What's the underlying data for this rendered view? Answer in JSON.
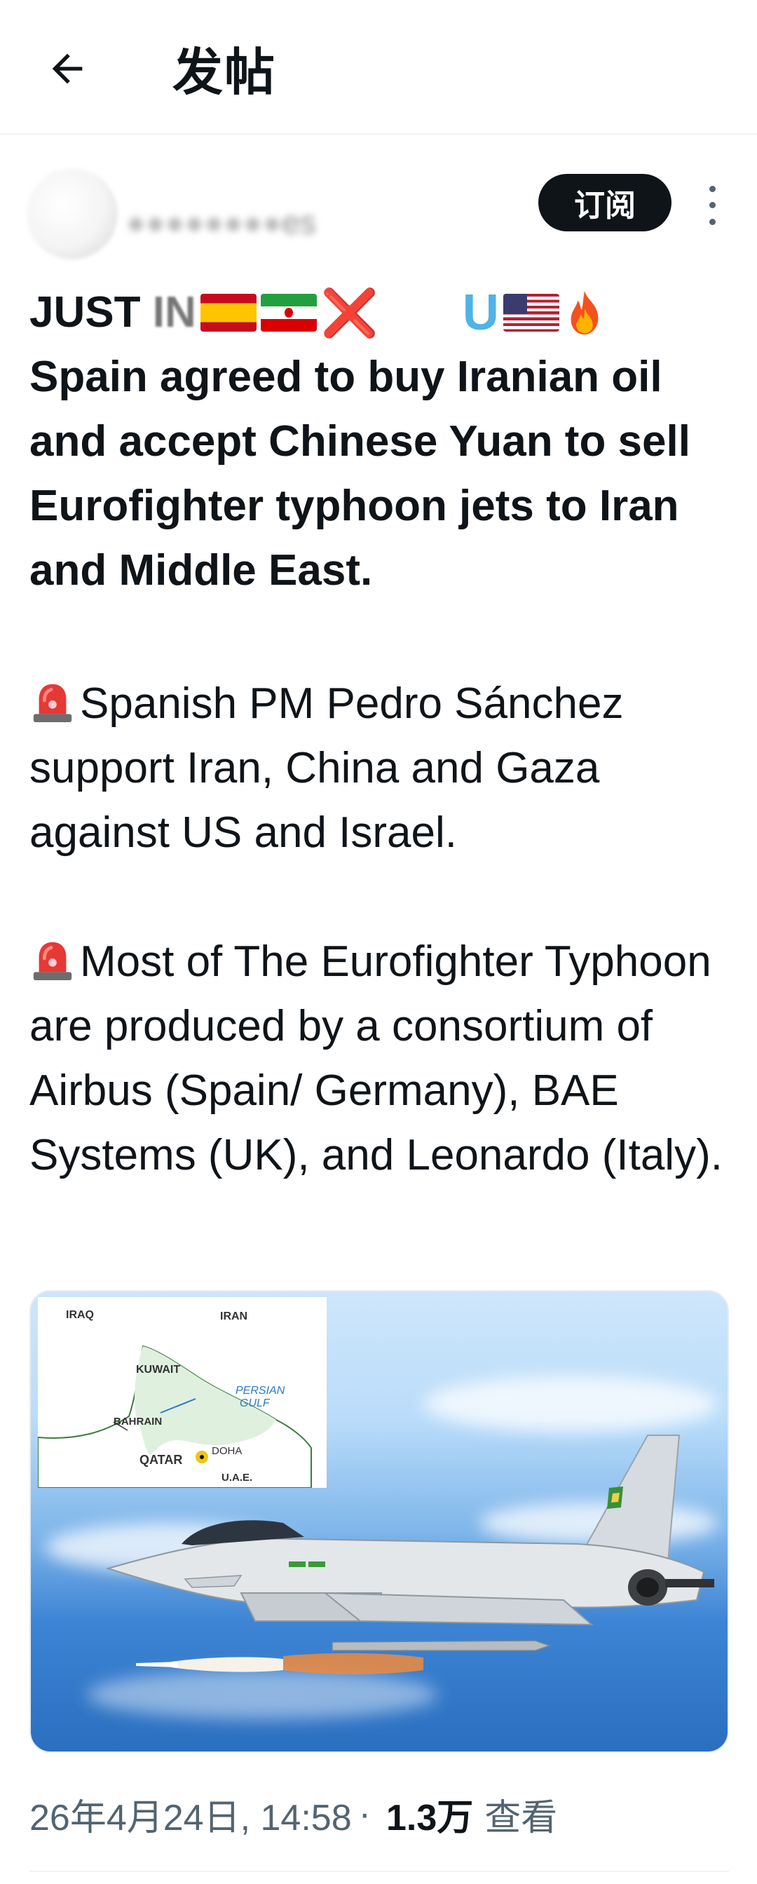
{
  "header": {
    "back_icon": "arrow-left-icon",
    "title": "发帖"
  },
  "author": {
    "name_visible_tail": "es",
    "subscribe_label": "订阅",
    "more_icon": "more-vertical-icon"
  },
  "tweet": {
    "headline_prefix": "JUST ",
    "headline_prefix_blurred": "IN",
    "headline_icons": [
      "spain-flag-icon",
      "iran-flag-icon",
      "cross-mark-icon",
      "u-letter-icon",
      "us-flag-icon",
      "fire-icon"
    ],
    "headline_u": "U",
    "headline_cross": "❌",
    "headline_text": "Spain agreed to buy Iranian oil and accept Chinese Yuan to sell Eurofighter typhoon jets to Iran and Middle East.",
    "paragraph_1": "Spanish PM Pedro Sánchez support Iran, China and Gaza against US and Israel.",
    "paragraph_2": "Most of The Eurofighter Typhoon are produced by a consortium of Airbus (Spain/ Germany), BAE Systems (UK), and Leonardo (Italy).",
    "paragraph_icon": "siren-icon"
  },
  "media": {
    "map_labels": {
      "iraq": "IRAQ",
      "iran": "IRAN",
      "kuwait": "KUWAIT",
      "persian_gulf_1": "PERSIAN",
      "persian_gulf_2": "GULF",
      "bahrain": "BAHRAIN",
      "doha": "DOHA",
      "qatar": "QATAR",
      "uae": "U.A.E."
    }
  },
  "meta": {
    "timestamp": "26年4月24日, 14:58",
    "separator": "·",
    "views_count": "1.3万",
    "views_label": "查看"
  },
  "colors": {
    "text_primary": "#0f1419",
    "text_secondary": "#536471",
    "subscribe_bg": "#0f1419"
  }
}
